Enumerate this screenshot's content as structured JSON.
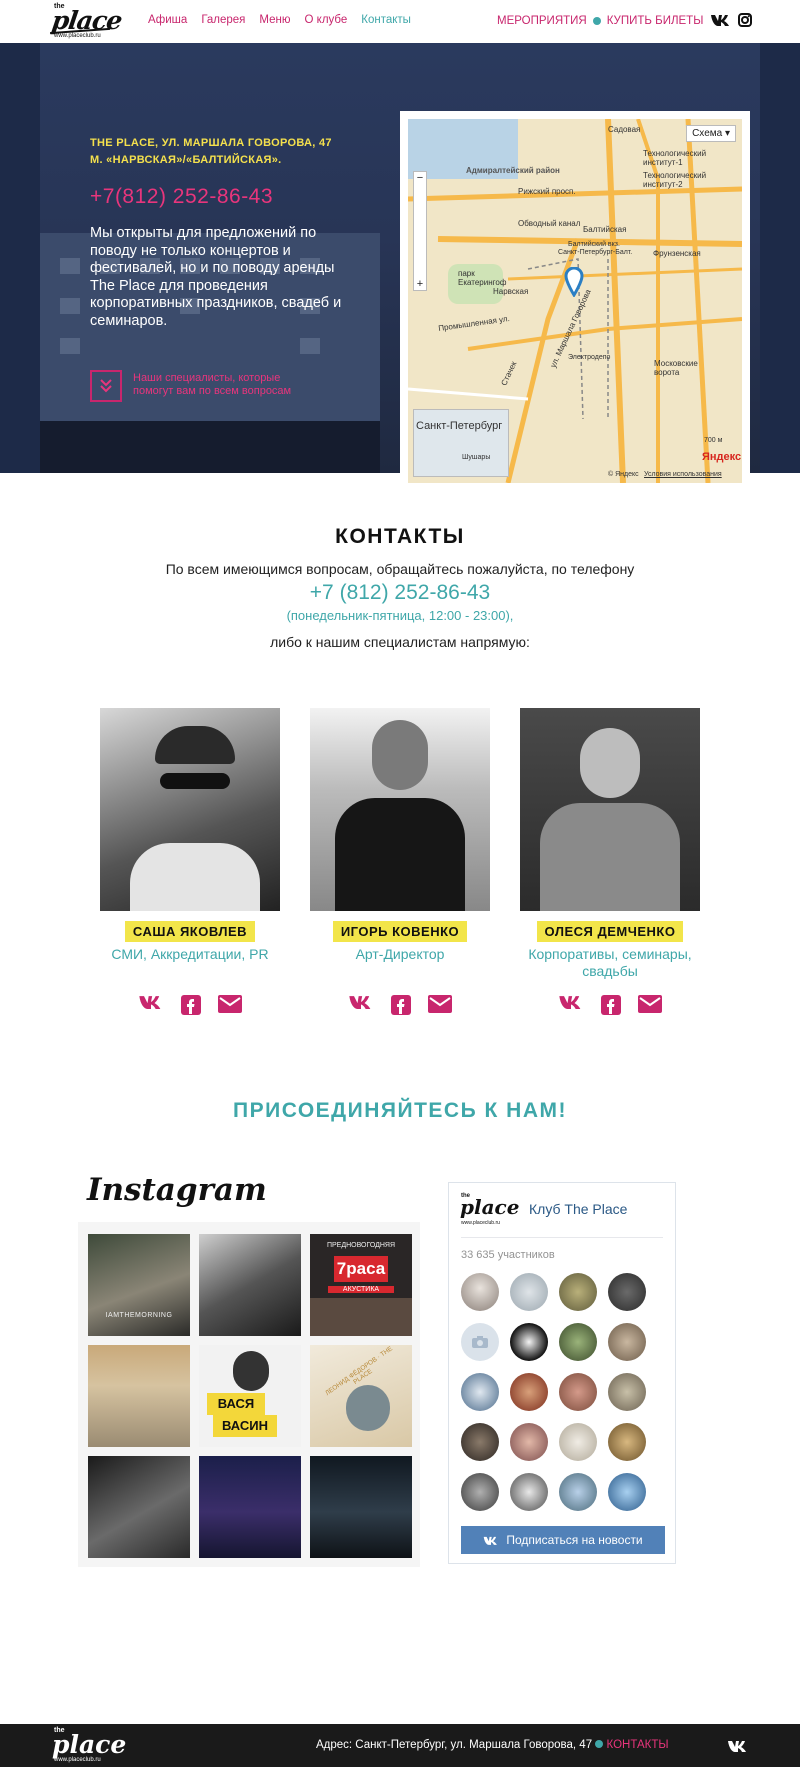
{
  "header": {
    "logo": {
      "small": "the",
      "main": "place",
      "url": "www.placeclub.ru"
    },
    "nav": [
      "Афиша",
      "Галерея",
      "Меню",
      "О клубе",
      "Контакты"
    ],
    "right": {
      "events": "МЕРОПРИЯТИЯ",
      "tickets": "КУПИТЬ БИЛЕТЫ"
    },
    "social_icons": [
      "vk-icon",
      "instagram-icon"
    ]
  },
  "hero": {
    "address_line1": "THE PLACE, УЛ. МАРШАЛА ГОВОРОВА, 47",
    "address_line2": "М. «НАРВСКАЯ»/«БАЛТИЙСКАЯ».",
    "phone": "+7(812) 252-86-43",
    "text": "Мы открыты для предложений по поводу не только концертов и фестивалей, но и по поводу аренды The Place для проведения корпоративных праздников, свадеб и семинаров.",
    "specialists_link": "Наши специалисты, которые помогут вам по всем вопросам",
    "map": {
      "schema_button": "Схема",
      "labels": {
        "district": "Адмиралтейский район",
        "sadovaya": "Садовая",
        "tech1": "Технологический институт-1",
        "tech2": "Технологический институт-2",
        "rizhsky": "Рижский просп.",
        "obvodny": "Обводный канал",
        "baltiyskaya": "Балтийская",
        "baltic_station": "Балтийский вкз.",
        "spb_station": "Санкт-Петербург-Балт.",
        "frunzenskaya": "Фрунзенская",
        "park": "парк Екатерингоф",
        "narvskaya": "Нарвская",
        "promyshlennaya": "Промышленная ул.",
        "marshal": "ул. Маршала Говорова",
        "stachek": "Стачек",
        "elektrodepo": "Электродепо",
        "moskovskie": "Московские ворота",
        "city": "Санкт-Петербург",
        "shushary": "Шушары",
        "scale": "700 м",
        "yandex": "Яндекс",
        "copyright": "© Яндекс",
        "terms": "Условия использования"
      }
    }
  },
  "contacts": {
    "title": "КОНТАКТЫ",
    "line1": "По всем имеющимся вопросам, обращайтесь пожалуйста, по телефону",
    "phone": "+7 (812) 252-86-43",
    "hours": "(понедельник-пятница, 12:00 - 23:00),",
    "line2": "либо к нашим специалистам напрямую:",
    "people": [
      {
        "name": "САША ЯКОВЛЕВ",
        "role": "СМИ, Аккредитации, PR"
      },
      {
        "name": "ИГОРЬ КОВЕНКО",
        "role": "Арт-Директор"
      },
      {
        "name": "ОЛЕСЯ ДЕМЧЕНКО",
        "role": "Корпоративы, семинары, свадьбы"
      }
    ]
  },
  "join": {
    "title": "ПРИСОЕДИНЯЙТЕСЬ К НАМ!"
  },
  "instagram": {
    "title": "Instagram",
    "tiles": {
      "t1": "IAMTHEMORNING",
      "t3_top": "ПРЕДНОВОГОДНЯЯ",
      "t3_main": "7раса",
      "t3_bottom": "АКУСТИКА",
      "t5_a": "ВАСЯ",
      "t5_b": "ВАСИН",
      "t6": "ЛЕОНИД ФЁДОРОВ · THE PLACE"
    }
  },
  "vk": {
    "group_name": "Клуб The Place",
    "members": "33 635 участников",
    "subscribe": "Подписаться на новости"
  },
  "footer": {
    "address": "Адрес: Санкт-Петербург, ул. Маршала Говорова, 47",
    "contacts_link": "КОНТАКТЫ"
  }
}
